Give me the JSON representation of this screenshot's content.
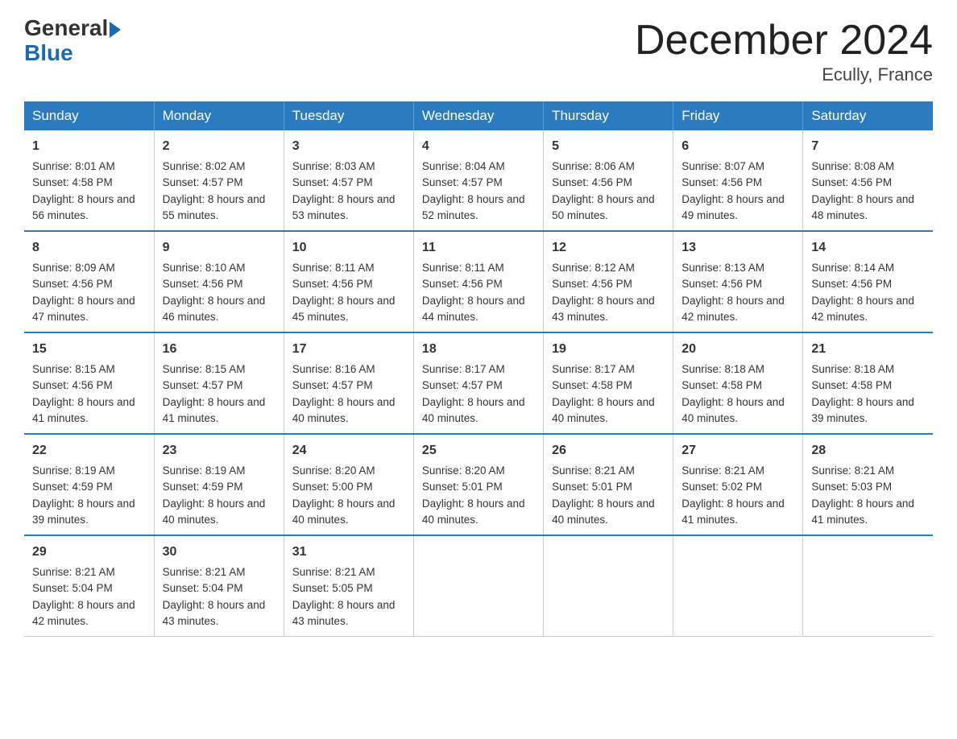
{
  "header": {
    "logo_general": "General",
    "logo_blue": "Blue",
    "title": "December 2024",
    "location": "Ecully, France"
  },
  "days_of_week": [
    "Sunday",
    "Monday",
    "Tuesday",
    "Wednesday",
    "Thursday",
    "Friday",
    "Saturday"
  ],
  "weeks": [
    [
      {
        "day": "1",
        "sunrise": "8:01 AM",
        "sunset": "4:58 PM",
        "daylight": "8 hours and 56 minutes."
      },
      {
        "day": "2",
        "sunrise": "8:02 AM",
        "sunset": "4:57 PM",
        "daylight": "8 hours and 55 minutes."
      },
      {
        "day": "3",
        "sunrise": "8:03 AM",
        "sunset": "4:57 PM",
        "daylight": "8 hours and 53 minutes."
      },
      {
        "day": "4",
        "sunrise": "8:04 AM",
        "sunset": "4:57 PM",
        "daylight": "8 hours and 52 minutes."
      },
      {
        "day": "5",
        "sunrise": "8:06 AM",
        "sunset": "4:56 PM",
        "daylight": "8 hours and 50 minutes."
      },
      {
        "day": "6",
        "sunrise": "8:07 AM",
        "sunset": "4:56 PM",
        "daylight": "8 hours and 49 minutes."
      },
      {
        "day": "7",
        "sunrise": "8:08 AM",
        "sunset": "4:56 PM",
        "daylight": "8 hours and 48 minutes."
      }
    ],
    [
      {
        "day": "8",
        "sunrise": "8:09 AM",
        "sunset": "4:56 PM",
        "daylight": "8 hours and 47 minutes."
      },
      {
        "day": "9",
        "sunrise": "8:10 AM",
        "sunset": "4:56 PM",
        "daylight": "8 hours and 46 minutes."
      },
      {
        "day": "10",
        "sunrise": "8:11 AM",
        "sunset": "4:56 PM",
        "daylight": "8 hours and 45 minutes."
      },
      {
        "day": "11",
        "sunrise": "8:11 AM",
        "sunset": "4:56 PM",
        "daylight": "8 hours and 44 minutes."
      },
      {
        "day": "12",
        "sunrise": "8:12 AM",
        "sunset": "4:56 PM",
        "daylight": "8 hours and 43 minutes."
      },
      {
        "day": "13",
        "sunrise": "8:13 AM",
        "sunset": "4:56 PM",
        "daylight": "8 hours and 42 minutes."
      },
      {
        "day": "14",
        "sunrise": "8:14 AM",
        "sunset": "4:56 PM",
        "daylight": "8 hours and 42 minutes."
      }
    ],
    [
      {
        "day": "15",
        "sunrise": "8:15 AM",
        "sunset": "4:56 PM",
        "daylight": "8 hours and 41 minutes."
      },
      {
        "day": "16",
        "sunrise": "8:15 AM",
        "sunset": "4:57 PM",
        "daylight": "8 hours and 41 minutes."
      },
      {
        "day": "17",
        "sunrise": "8:16 AM",
        "sunset": "4:57 PM",
        "daylight": "8 hours and 40 minutes."
      },
      {
        "day": "18",
        "sunrise": "8:17 AM",
        "sunset": "4:57 PM",
        "daylight": "8 hours and 40 minutes."
      },
      {
        "day": "19",
        "sunrise": "8:17 AM",
        "sunset": "4:58 PM",
        "daylight": "8 hours and 40 minutes."
      },
      {
        "day": "20",
        "sunrise": "8:18 AM",
        "sunset": "4:58 PM",
        "daylight": "8 hours and 40 minutes."
      },
      {
        "day": "21",
        "sunrise": "8:18 AM",
        "sunset": "4:58 PM",
        "daylight": "8 hours and 39 minutes."
      }
    ],
    [
      {
        "day": "22",
        "sunrise": "8:19 AM",
        "sunset": "4:59 PM",
        "daylight": "8 hours and 39 minutes."
      },
      {
        "day": "23",
        "sunrise": "8:19 AM",
        "sunset": "4:59 PM",
        "daylight": "8 hours and 40 minutes."
      },
      {
        "day": "24",
        "sunrise": "8:20 AM",
        "sunset": "5:00 PM",
        "daylight": "8 hours and 40 minutes."
      },
      {
        "day": "25",
        "sunrise": "8:20 AM",
        "sunset": "5:01 PM",
        "daylight": "8 hours and 40 minutes."
      },
      {
        "day": "26",
        "sunrise": "8:21 AM",
        "sunset": "5:01 PM",
        "daylight": "8 hours and 40 minutes."
      },
      {
        "day": "27",
        "sunrise": "8:21 AM",
        "sunset": "5:02 PM",
        "daylight": "8 hours and 41 minutes."
      },
      {
        "day": "28",
        "sunrise": "8:21 AM",
        "sunset": "5:03 PM",
        "daylight": "8 hours and 41 minutes."
      }
    ],
    [
      {
        "day": "29",
        "sunrise": "8:21 AM",
        "sunset": "5:04 PM",
        "daylight": "8 hours and 42 minutes."
      },
      {
        "day": "30",
        "sunrise": "8:21 AM",
        "sunset": "5:04 PM",
        "daylight": "8 hours and 43 minutes."
      },
      {
        "day": "31",
        "sunrise": "8:21 AM",
        "sunset": "5:05 PM",
        "daylight": "8 hours and 43 minutes."
      },
      null,
      null,
      null,
      null
    ]
  ]
}
